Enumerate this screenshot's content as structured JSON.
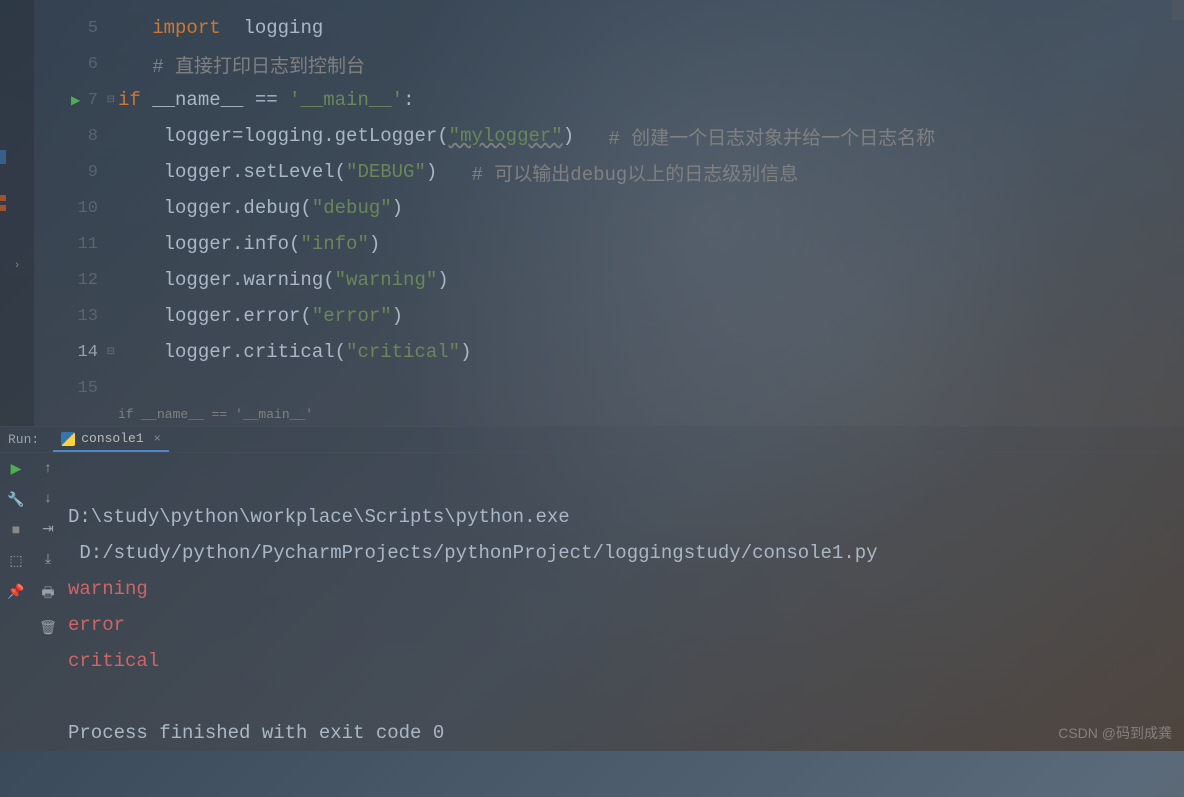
{
  "editor": {
    "lines": [
      {
        "num": "5",
        "tokens": [
          {
            "t": "import ",
            "c": "k-import"
          },
          {
            "t": " logging",
            "c": "k-name"
          }
        ],
        "prefix": "   "
      },
      {
        "num": "6",
        "tokens": [
          {
            "t": "# 直接打印日志到控制台",
            "c": "k-comment"
          }
        ],
        "prefix": "   "
      },
      {
        "num": "7",
        "run": true,
        "fold": true,
        "tokens": [
          {
            "t": "if ",
            "c": "k-keyword"
          },
          {
            "t": "__name__ == ",
            "c": "k-name"
          },
          {
            "t": "'__main__'",
            "c": "k-string"
          },
          {
            "t": ":",
            "c": "k-op"
          }
        ],
        "prefix": ""
      },
      {
        "num": "8",
        "tokens": [
          {
            "t": "logger",
            "c": "k-name"
          },
          {
            "t": "=",
            "c": "k-op"
          },
          {
            "t": "logging.getLogger(",
            "c": "k-name"
          },
          {
            "t": "\"mylogger\"",
            "c": "k-warn"
          },
          {
            "t": ")   ",
            "c": "k-name"
          },
          {
            "t": "# 创建一个日志对象并给一个日志名称",
            "c": "k-comment"
          }
        ],
        "prefix": "    "
      },
      {
        "num": "9",
        "tokens": [
          {
            "t": "logger.setLevel(",
            "c": "k-name"
          },
          {
            "t": "\"DEBUG\"",
            "c": "k-string"
          },
          {
            "t": ")   ",
            "c": "k-name"
          },
          {
            "t": "# 可以输出debug以上的日志级别信息",
            "c": "k-comment"
          }
        ],
        "prefix": "    "
      },
      {
        "num": "10",
        "tokens": [
          {
            "t": "logger.debug(",
            "c": "k-name"
          },
          {
            "t": "\"debug\"",
            "c": "k-string"
          },
          {
            "t": ")",
            "c": "k-name"
          }
        ],
        "prefix": "    "
      },
      {
        "num": "11",
        "tokens": [
          {
            "t": "logger.info(",
            "c": "k-name"
          },
          {
            "t": "\"info\"",
            "c": "k-string"
          },
          {
            "t": ")",
            "c": "k-name"
          }
        ],
        "prefix": "    "
      },
      {
        "num": "12",
        "tokens": [
          {
            "t": "logger.warning(",
            "c": "k-name"
          },
          {
            "t": "\"warning\"",
            "c": "k-string"
          },
          {
            "t": ")",
            "c": "k-name"
          }
        ],
        "prefix": "    "
      },
      {
        "num": "13",
        "tokens": [
          {
            "t": "logger.error(",
            "c": "k-name"
          },
          {
            "t": "\"error\"",
            "c": "k-string"
          },
          {
            "t": ")",
            "c": "k-name"
          }
        ],
        "prefix": "    "
      },
      {
        "num": "14",
        "fold": true,
        "current": true,
        "tokens": [
          {
            "t": "logger.critical(",
            "c": "k-name"
          },
          {
            "t": "\"critical\"",
            "c": "k-string"
          },
          {
            "t": ")",
            "c": "k-name"
          }
        ],
        "prefix": "    "
      },
      {
        "num": "15",
        "tokens": [],
        "prefix": ""
      }
    ],
    "breadcrumb": "if __name__ == '__main__'"
  },
  "run": {
    "label": "Run:",
    "tab": "console1",
    "output": {
      "line1": "D:\\study\\python\\workplace\\Scripts\\python.exe ",
      "line2": " D:/study/python/PycharmProjects/pythonProject/loggingstudy/console1.py",
      "err1": "warning",
      "err2": "error",
      "err3": "critical",
      "blank": "",
      "exit": "Process finished with exit code 0"
    }
  },
  "watermark": "CSDN @码到成龚"
}
